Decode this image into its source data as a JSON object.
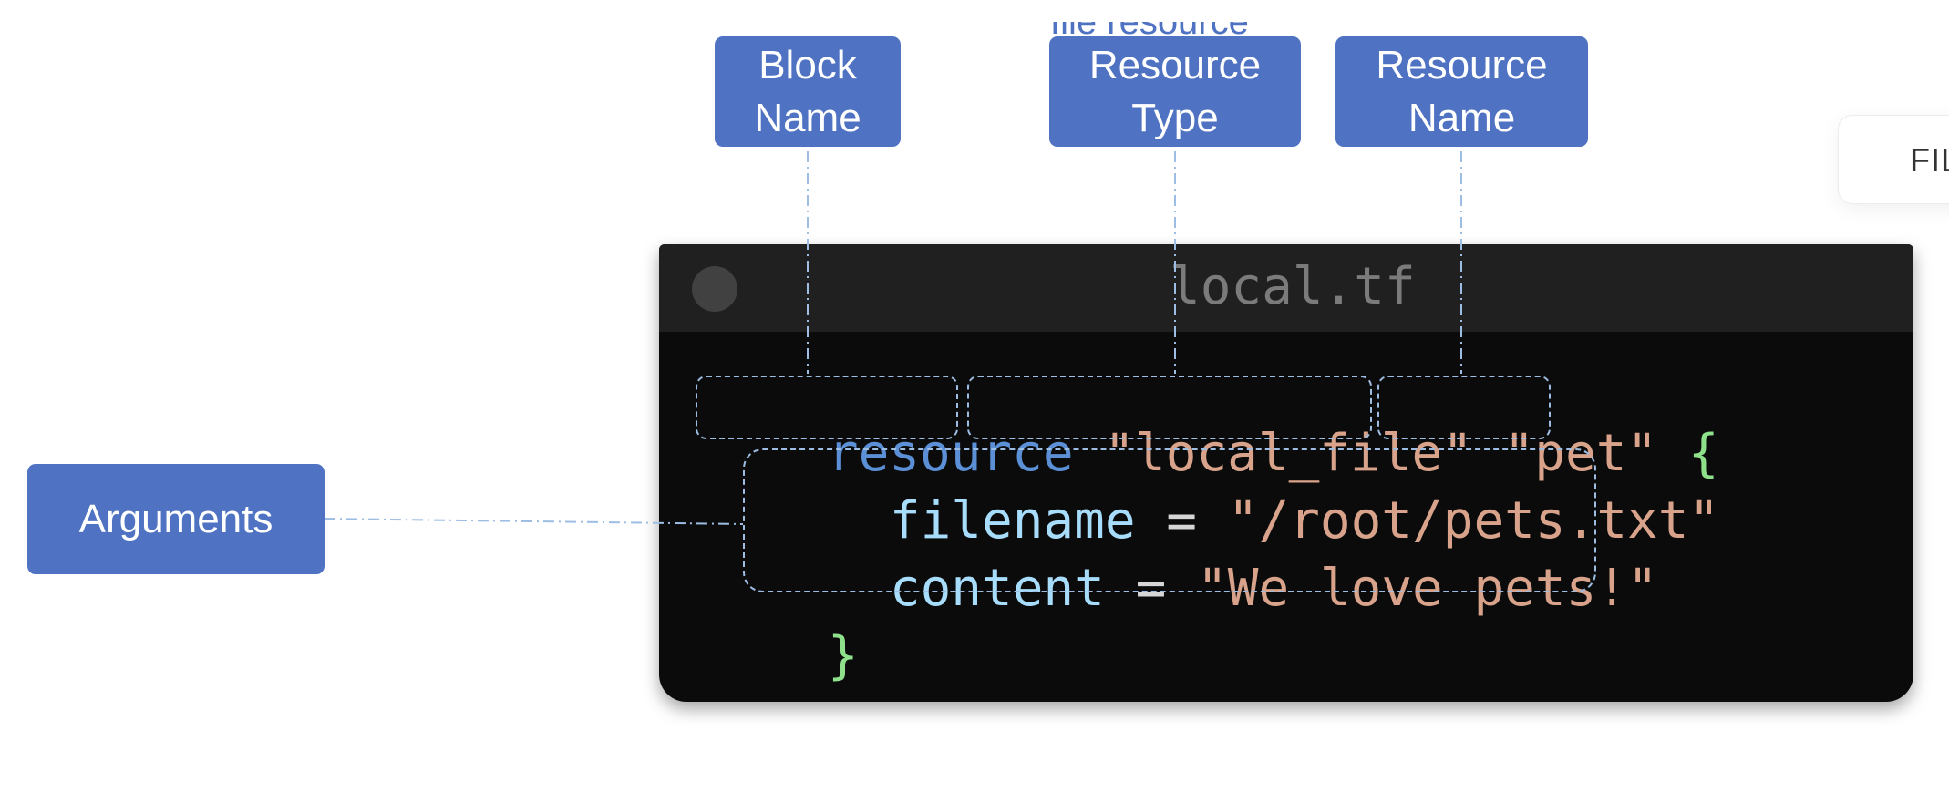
{
  "callouts": {
    "block_name": "Block\nName",
    "resource_type": "Resource\nType",
    "resource_name": "Resource\nName",
    "arguments": "Arguments",
    "clipped_top": "file resource"
  },
  "side_card": {
    "label": "FIL"
  },
  "editor": {
    "file_name": "local.tf",
    "line1": {
      "keyword": "resource",
      "type": "\"local_file\"",
      "name": "\"pet\"",
      "open_brace": "{"
    },
    "line2": {
      "key": "filename",
      "op": " = ",
      "value": "\"/root/pets.txt\""
    },
    "line3": {
      "key": "content",
      "op": " = ",
      "value": "\"We love pets!\""
    },
    "line4": {
      "close_brace": "}"
    }
  },
  "colors": {
    "callout": "#4f72c2",
    "leader": "#9dbde3",
    "keyword": "#5b8fd6",
    "string": "#d8a38a",
    "attribute": "#a8dcfb",
    "brace": "#8ee08a"
  }
}
